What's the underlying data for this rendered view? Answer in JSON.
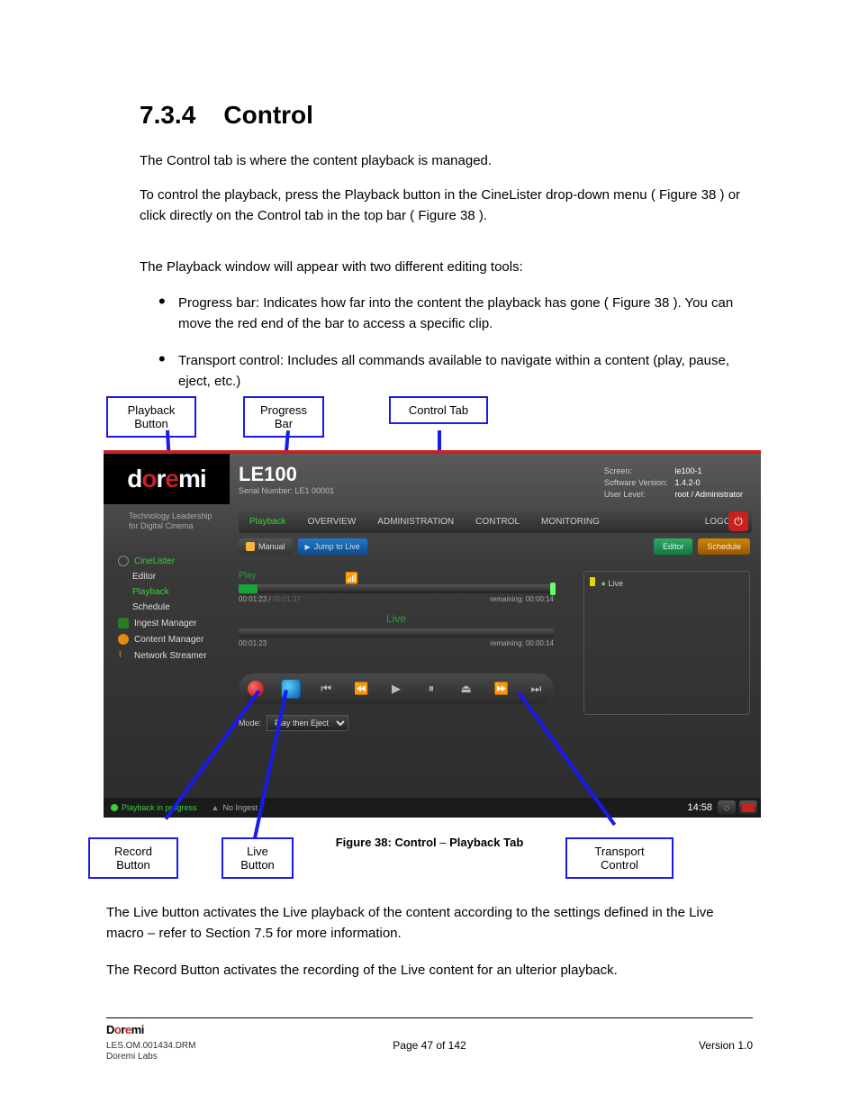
{
  "doc": {
    "section_no": "7.3.4",
    "heading": "Control",
    "p1": "The Control tab is where the content playback is managed.",
    "p2a": "To control the playback, press the Playback button in the CineLister drop-down menu (",
    "p2b": ") or click directly on the Control tab in the top bar (",
    "p2c": ").",
    "fig_ref1": "Figure 38",
    "fig_ref2": "Figure 38",
    "p3": "The Playback window will appear with two different editing tools:",
    "bullet1a": "Progress bar: Indicates how far into the content the playback has gone (",
    "bullet1b": "). You can move the red end of the bar to access a specific clip.",
    "bullet2": "Transport control: Includes all commands available to navigate within a content (play, pause, eject, etc.)",
    "fig_ref3": "Figure 38"
  },
  "callouts": {
    "playback": "Playback Button",
    "progress": "Progress Bar",
    "control": "Control Tab",
    "record": "Record Button",
    "live": "Live Button",
    "transport": "Transport Control"
  },
  "caption": {
    "fig": "Figure 38: Control",
    "dash": "–",
    "tab": " Playback Tab"
  },
  "post": {
    "p1a": "The Live button activates the Live playback of the content according to the settings defined in the Live macro – refer to Section ",
    "p1b": " for more information.",
    "secref": "7.5",
    "p2": "The Record Button activates the recording of the Live content for an ulterior playback."
  },
  "footer": {
    "left1": "LES.OM.001434.DRM",
    "left2": "Doremi Labs",
    "center": "Page 47 of 142",
    "right": "Version 1.0"
  },
  "ui": {
    "model": "LE100",
    "serial_label": "Serial Number:",
    "serial": "LE1 00001",
    "sys": {
      "screen_l": "Screen:",
      "screen_v": "le100-1",
      "ver_l": "Software Version:",
      "ver_v": "1.4.2-0",
      "user_l": "User Level:",
      "user_v": "root / Administrator"
    },
    "tagline1": "Technology Leadership",
    "tagline2": "for Digital Cinema",
    "topbar": {
      "playback": "Playback",
      "overview": "OVERVIEW",
      "admin": "ADMINISTRATION",
      "control": "CONTROL",
      "monitor": "MONITORING",
      "logout": "LOGOUT"
    },
    "sub": {
      "manual": "Manual",
      "jump": "Jump to Live"
    },
    "rchips": {
      "editor": "Editor",
      "schedule": "Schedule"
    },
    "nav": {
      "cinelister": "CineLister",
      "editor": "Editor",
      "playback": "Playback",
      "schedule": "Schedule",
      "ingest": "Ingest Manager",
      "content": "Content Manager",
      "network": "Network Streamer"
    },
    "play": {
      "label": "Play",
      "t_elapsed": "00:01:23",
      "t_total": "00:01:37",
      "t_remain_l": "remaining:",
      "t_remain": "00:00:14",
      "live_label": "Live",
      "t2_elapsed": "00:01:23",
      "t2_remain": "00:00:14"
    },
    "mode": {
      "label": "Mode:",
      "value": "Play then Eject"
    },
    "livepanel": {
      "item": "Live"
    },
    "status": {
      "play": "Playback in progress",
      "ingest": "No Ingest",
      "clock": "14:58"
    }
  }
}
